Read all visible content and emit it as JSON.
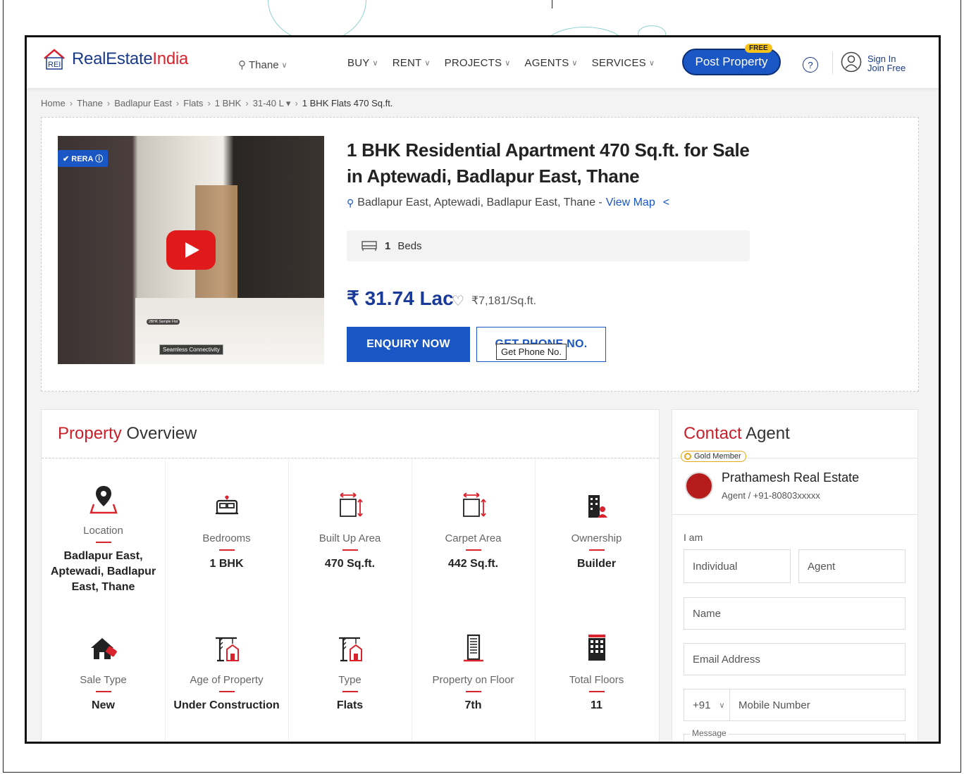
{
  "header": {
    "logo_text_1": "RealEstate",
    "logo_text_2": "India",
    "city": "Thane",
    "nav": [
      "BUY",
      "RENT",
      "PROJECTS",
      "AGENTS",
      "SERVICES"
    ],
    "post_property": "Post Property",
    "free_badge": "FREE",
    "help": "?",
    "sign_in": "Sign In",
    "join_free": "Join Free"
  },
  "breadcrumb": {
    "items": [
      "Home",
      "Thane",
      "Badlapur East",
      "Flats",
      "1 BHK",
      "31-40 L ▾"
    ],
    "current": "1 BHK Flats 470 Sq.ft."
  },
  "listing": {
    "rera": "✔ RERA ⓘ",
    "media_caption": "Seamless Connectivity",
    "media_caption_small": "2BHK Sample Flat",
    "title": "1 BHK Residential Apartment 470 Sq.ft. for Sale in Aptewadi, Badlapur East, Thane",
    "address": "Badlapur East, Aptewadi, Badlapur East, Thane -",
    "view_map": "View Map",
    "beds_count": "1",
    "beds_label": "Beds",
    "price": "₹ 31.74 Lac",
    "price_per_sqft": "₹7,181/Sq.ft.",
    "enquiry_button": "ENQUIRY NOW",
    "phone_button": "GET PHONE NO.",
    "phone_tooltip": "Get Phone No."
  },
  "overview": {
    "title_1": "Property",
    "title_2": " Overview",
    "items": [
      {
        "label": "Location",
        "value": "Badlapur East, Aptewadi, Badlapur East, Thane",
        "icon": "location-pin-icon"
      },
      {
        "label": "Bedrooms",
        "value": "1 BHK",
        "icon": "bed-icon"
      },
      {
        "label": "Built Up Area",
        "value": "470 Sq.ft.",
        "icon": "area-icon"
      },
      {
        "label": "Carpet Area",
        "value": "442 Sq.ft.",
        "icon": "carpet-area-icon"
      },
      {
        "label": "Ownership",
        "value": "Builder",
        "icon": "building-owner-icon"
      },
      {
        "label": "Sale Type",
        "value": "New",
        "icon": "house-sale-icon"
      },
      {
        "label": "Age of Property",
        "value": "Under Construction",
        "icon": "crane-icon"
      },
      {
        "label": "Type",
        "value": "Flats",
        "icon": "crane-flats-icon"
      },
      {
        "label": "Property on Floor",
        "value": "7th",
        "icon": "floor-building-icon"
      },
      {
        "label": "Total Floors",
        "value": "11",
        "icon": "tower-icon"
      }
    ]
  },
  "contact": {
    "title_1": "Contact",
    "title_2": " Agent",
    "gold_member": "Gold Member",
    "agent_name": "Prathamesh Real Estate",
    "agent_sub": "Agent / +91-80803xxxxx",
    "i_am": "I am",
    "individual": "Individual",
    "agent": "Agent",
    "name_placeholder": "Name",
    "email_placeholder": "Email Address",
    "country_code": "+91",
    "mobile_placeholder": "Mobile Number",
    "message_label": "Message"
  },
  "colors": {
    "brand_blue": "#1a56c4",
    "brand_red": "#d9232d",
    "price_blue": "#1a3a9a"
  }
}
